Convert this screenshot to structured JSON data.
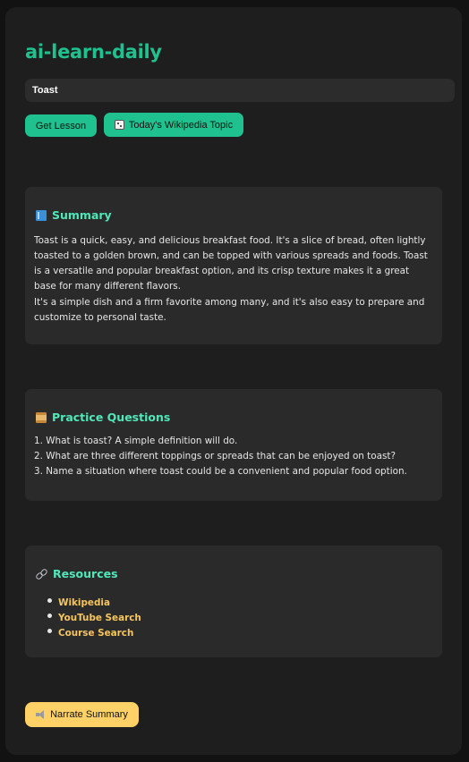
{
  "app": {
    "title": "ai-learn-daily"
  },
  "topic_input": {
    "value": "Toast",
    "placeholder": ""
  },
  "buttons": {
    "get_lesson": "Get Lesson",
    "wikipedia_topic": "Today's Wikipedia Topic",
    "wikipedia_topic_icon": "dice-icon",
    "narrate_summary": "Narrate Summary",
    "narrate_summary_icon": "speaker-icon"
  },
  "summary": {
    "heading": "Summary",
    "icon": "book-icon",
    "paragraphs": [
      "Toast is a quick, easy, and delicious breakfast food. It's a slice of bread, often lightly toasted to a golden brown, and can be topped with various spreads and foods. Toast is a versatile and popular breakfast option, and its crisp texture makes it a great base for many different flavors.",
      "It's a simple dish and a firm favorite among many, and it's also easy to prepare and customize to personal taste."
    ]
  },
  "practice_questions": {
    "heading": "Practice Questions",
    "icon": "scroll-icon",
    "items": [
      "1. What is toast? A simple definition will do.",
      "2. What are three different toppings or spreads that can be enjoyed on toast?",
      "3. Name a situation where toast could be a convenient and popular food option."
    ]
  },
  "resources": {
    "heading": "Resources",
    "icon": "link-icon",
    "links": [
      "Wikipedia",
      "YouTube Search",
      "Course Search"
    ]
  },
  "colors": {
    "accent": "#1fc28e",
    "heading": "#4fe8b8",
    "link": "#f7c55e",
    "narrate_button": "#ffd166",
    "background": "#1e1e1e",
    "card": "#2a2a2a"
  }
}
